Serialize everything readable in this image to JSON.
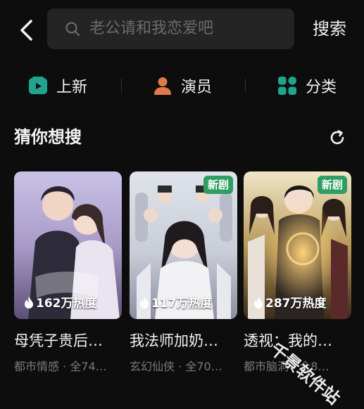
{
  "search": {
    "placeholder": "老公请和我恋爱吧",
    "button_label": "搜索"
  },
  "categories": [
    {
      "label": "上新",
      "icon": "play-tv-icon",
      "color": "#1fa58f"
    },
    {
      "label": "演员",
      "icon": "person-icon",
      "color": "#e07a4a"
    },
    {
      "label": "分类",
      "icon": "grid-icon",
      "color": "#1fa58f"
    }
  ],
  "section": {
    "title": "猜你想搜"
  },
  "cards": [
    {
      "title": "母凭子贵后…",
      "meta": "都市情感 · 全74…",
      "heat": "162万热度",
      "badge": ""
    },
    {
      "title": "我法师加奶…",
      "meta": "玄幻仙侠 · 全70…",
      "heat": "117万热度",
      "badge": "新剧"
    },
    {
      "title": "透视：我的…",
      "meta": "都市脑洞 · 全8…",
      "heat": "287万热度",
      "badge": "新剧"
    }
  ],
  "watermark": "千景软件站",
  "colors": {
    "background": "#0d0d0d",
    "badge": "#2f9e62",
    "accent": "#1fa58f"
  }
}
